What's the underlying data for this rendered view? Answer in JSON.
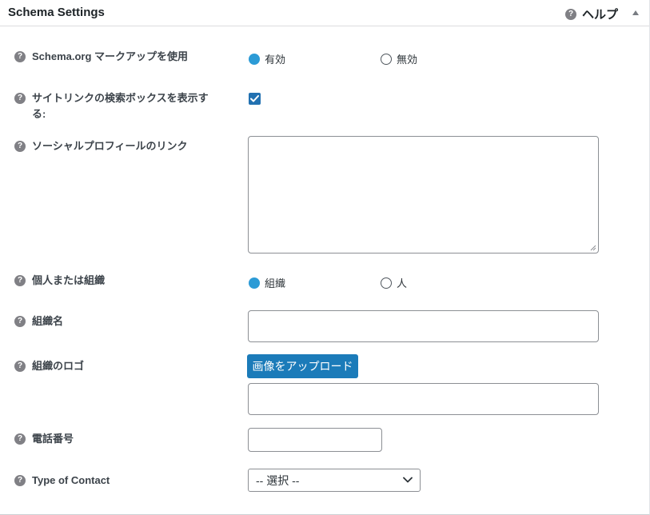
{
  "header": {
    "title": "Schema Settings",
    "help_label": "ヘルプ"
  },
  "rows": {
    "markup": {
      "label": "Schema.org マークアップを使用",
      "options": [
        "有効",
        "無効"
      ],
      "selected": "有効"
    },
    "sitelinks": {
      "label_line1": "サイトリンクの検索ボックスを表示す",
      "label_line2": "る:",
      "checked": true
    },
    "social": {
      "label": "ソーシャルプロフィールのリンク",
      "value": ""
    },
    "person_org": {
      "label": "個人または組織",
      "options": [
        "組織",
        "人"
      ],
      "selected": "組織"
    },
    "org_name": {
      "label": "組織名",
      "value": ""
    },
    "org_logo": {
      "label": "組織のロゴ",
      "button_label": "画像をアップロード",
      "value": ""
    },
    "phone": {
      "label": "電話番号",
      "value": ""
    },
    "contact_type": {
      "label": "Type of Contact",
      "selected": "-- 選択 --"
    }
  },
  "colors": {
    "accent": "#2271b1",
    "button": "#1b7bb9",
    "radio_selected": "#2c9bd6"
  }
}
